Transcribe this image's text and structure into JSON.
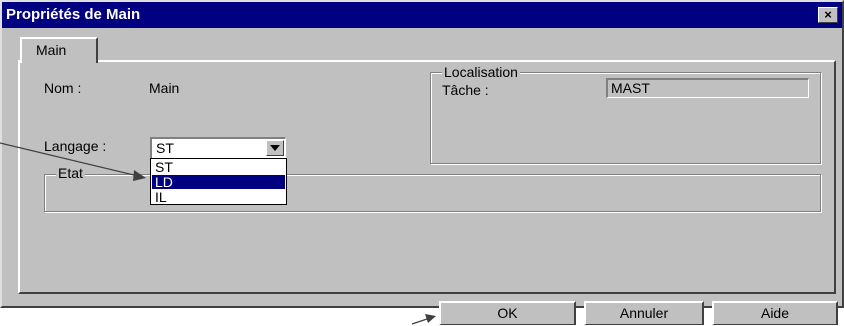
{
  "window": {
    "title": "Propriétés de Main",
    "close_label": "×"
  },
  "tabs": [
    {
      "label": "Main"
    }
  ],
  "general": {
    "nom_label": "Nom :",
    "nom_value": "Main",
    "langage_label": "Langage :",
    "langage_value": "ST",
    "langage_options": [
      "ST",
      "LD",
      "IL"
    ],
    "langage_highlighted": "LD"
  },
  "localisation": {
    "legend": "Localisation",
    "tache_label": "Tâche :",
    "tache_value": "MAST"
  },
  "etat": {
    "legend": "Etat"
  },
  "buttons": {
    "ok": "OK",
    "cancel": "Annuler",
    "help": "Aide"
  },
  "colors": {
    "titlebar": "#000080",
    "face": "#c0c0c0",
    "selection": "#000080"
  }
}
